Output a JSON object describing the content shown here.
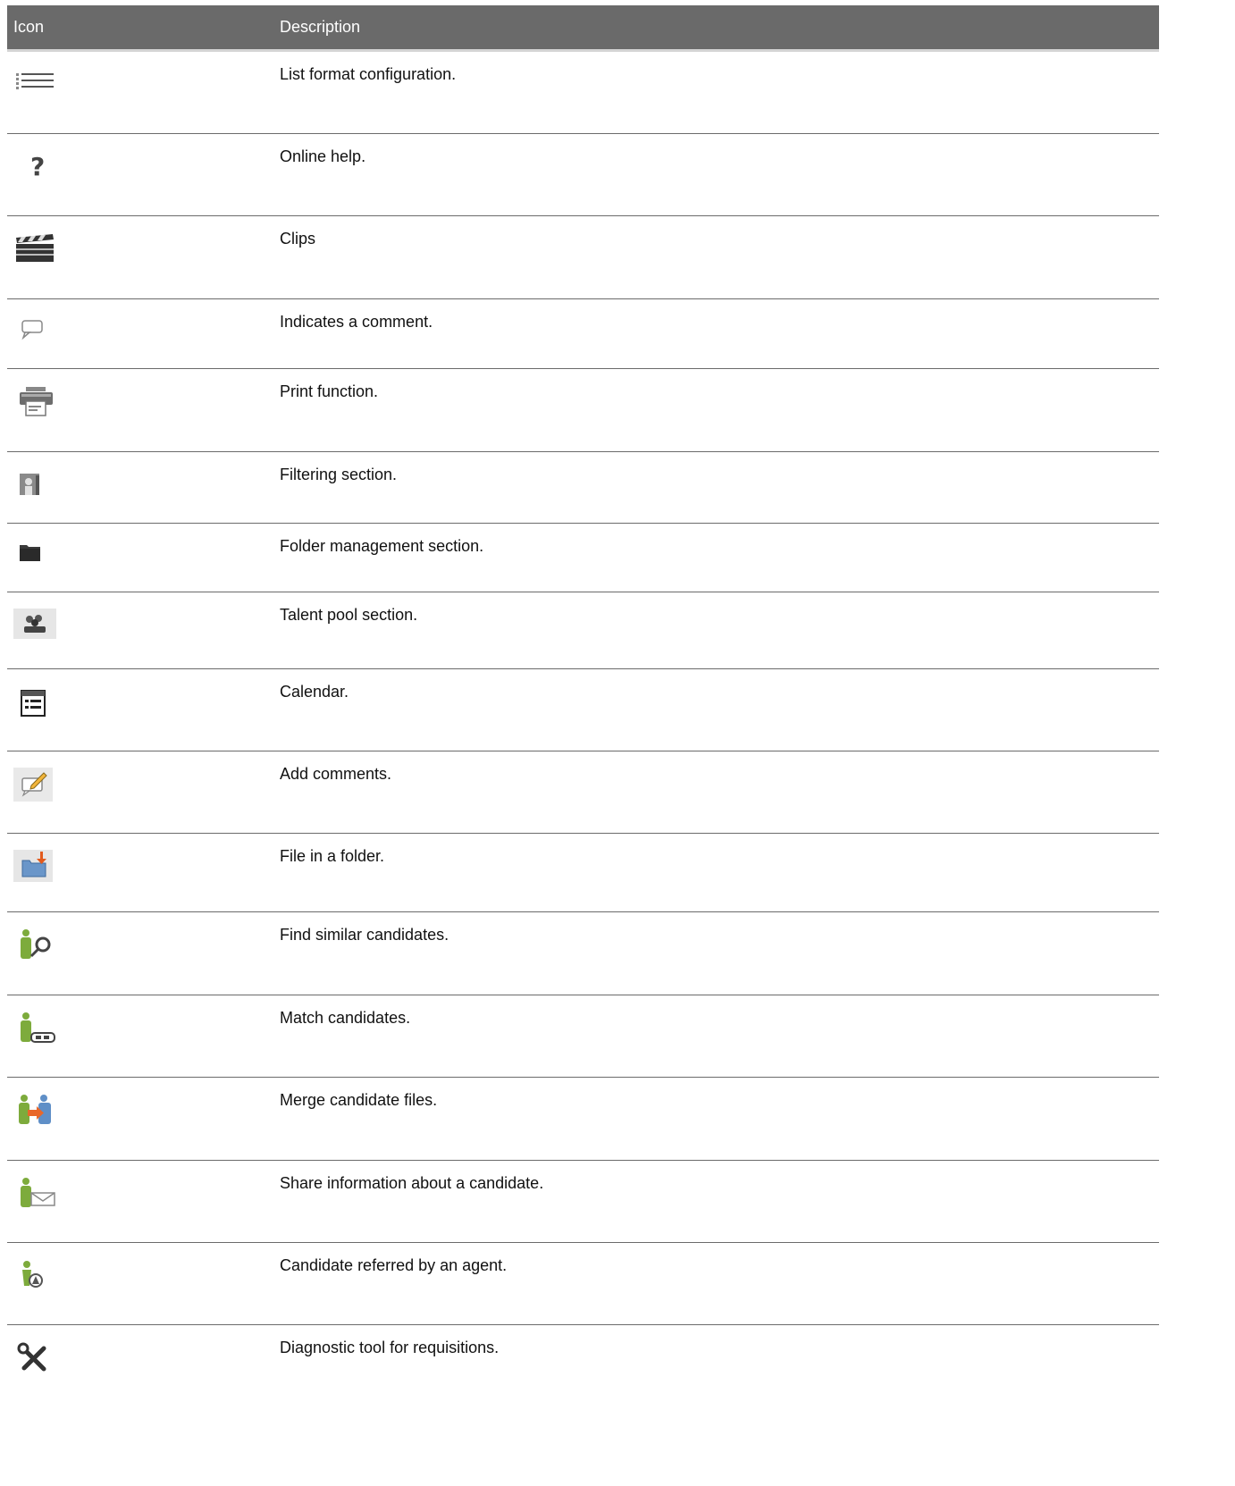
{
  "table": {
    "header": {
      "icon_col": "Icon",
      "description_col": "Description"
    },
    "rows": [
      {
        "icon": "list-format-icon",
        "description": "List format configuration."
      },
      {
        "icon": "help-question-icon",
        "description": "Online help."
      },
      {
        "icon": "clapperboard-icon",
        "description": "Clips"
      },
      {
        "icon": "comment-bubble-icon",
        "description": "Indicates a comment."
      },
      {
        "icon": "printer-icon",
        "description": "Print function."
      },
      {
        "icon": "filter-person-icon",
        "description": "Filtering section."
      },
      {
        "icon": "folder-icon",
        "description": "Folder management section."
      },
      {
        "icon": "talent-pool-icon",
        "description": "Talent pool section."
      },
      {
        "icon": "calendar-icon",
        "description": "Calendar."
      },
      {
        "icon": "add-comment-icon",
        "description": "Add comments."
      },
      {
        "icon": "file-in-folder-icon",
        "description": "File in a folder."
      },
      {
        "icon": "find-similar-candidates-icon",
        "description": "Find similar candidates."
      },
      {
        "icon": "match-candidates-icon",
        "description": "Match candidates."
      },
      {
        "icon": "merge-candidates-icon",
        "description": "Merge candidate files."
      },
      {
        "icon": "share-candidate-icon",
        "description": "Share information about a candidate."
      },
      {
        "icon": "agent-referral-icon",
        "description": "Candidate referred by an agent."
      },
      {
        "icon": "diagnostic-tool-icon",
        "description": "Diagnostic tool for requisitions."
      }
    ]
  },
  "colors": {
    "header_bg": "#6a6a6a",
    "header_text": "#ffffff",
    "row_divider": "#6b6b6b",
    "candidate_green": "#7dab3c"
  }
}
